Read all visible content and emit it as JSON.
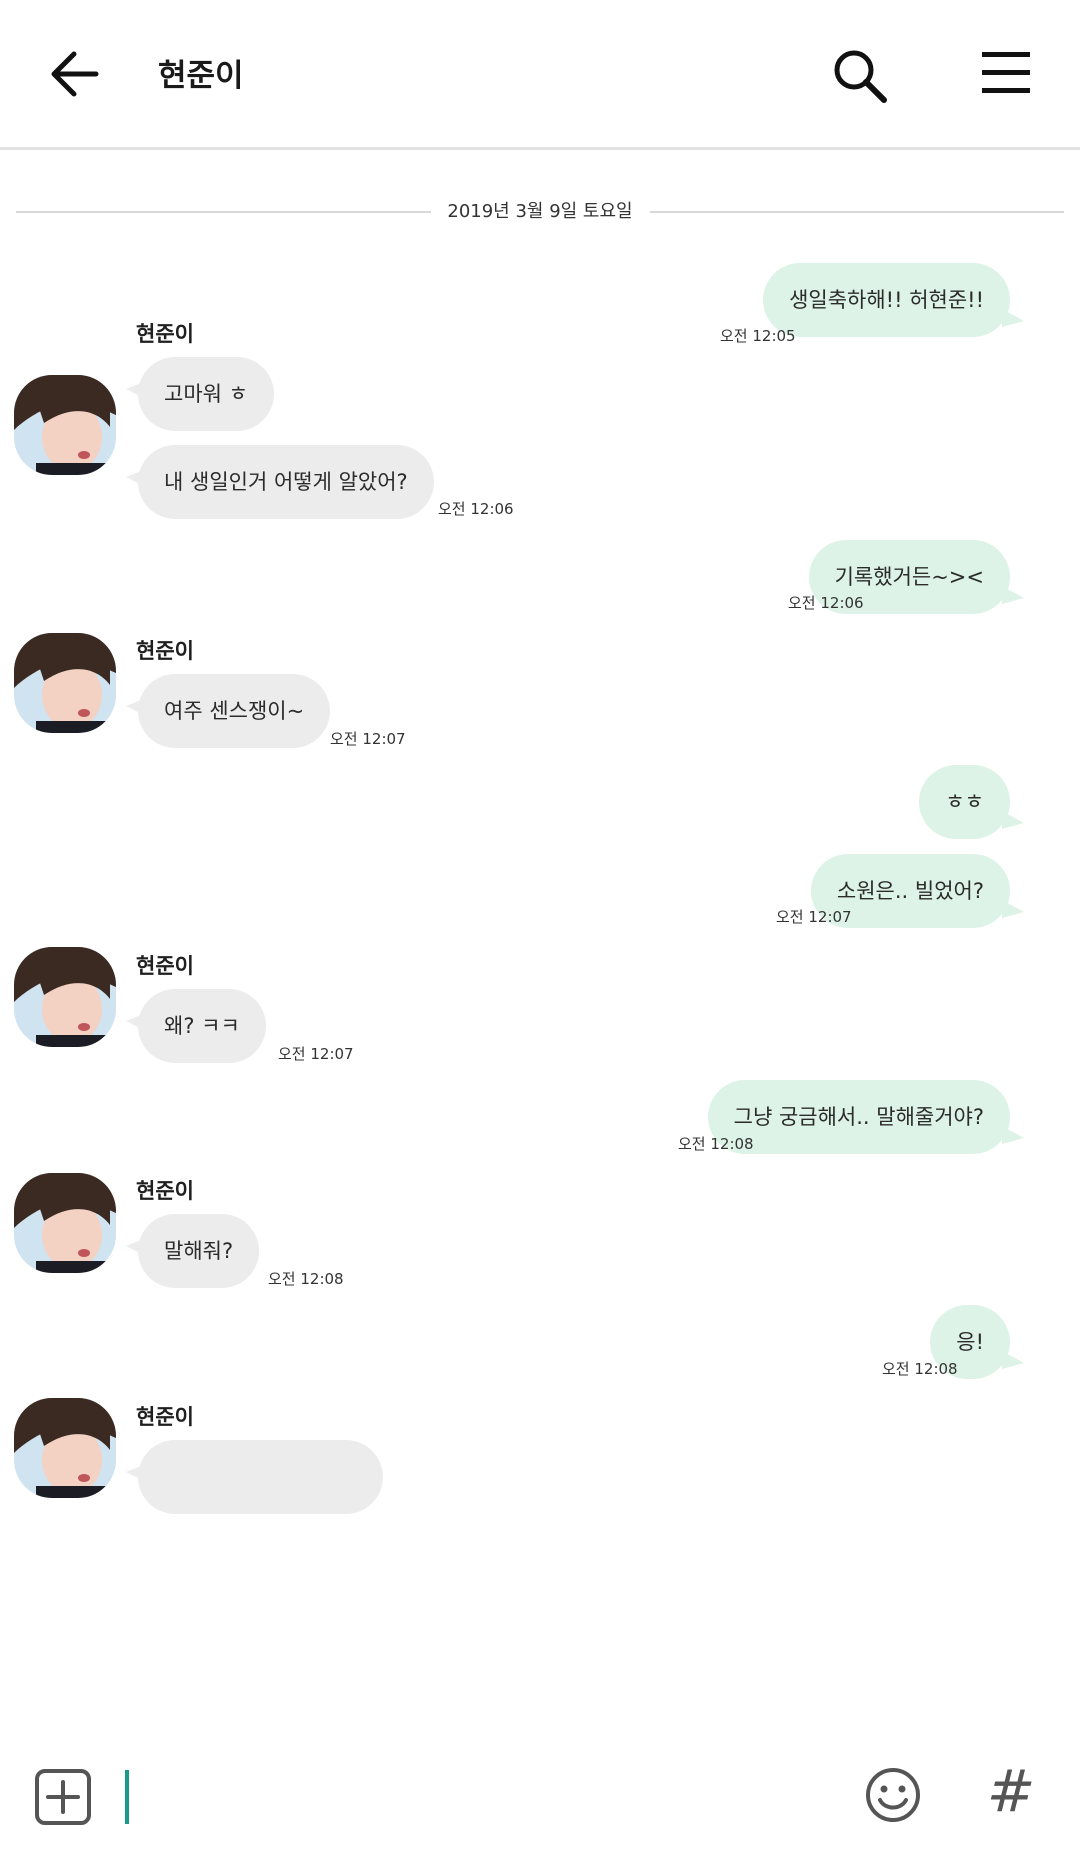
{
  "header": {
    "title": "현준이",
    "back_icon": "arrow-left-icon",
    "search_icon": "search-icon",
    "menu_icon": "hamburger-menu-icon"
  },
  "date_divider": "2019년 3월 9일 토요일",
  "messages": [
    {
      "dir": "out",
      "text": "생일축하해!! 허현준!!",
      "time": "오전 12:05"
    },
    {
      "dir": "in",
      "sender": "현준이",
      "text": "고마워 ㅎ"
    },
    {
      "dir": "in",
      "text": "내 생일인거 어떻게 알았어?",
      "time": "오전 12:06"
    },
    {
      "dir": "out",
      "text": "기록했거든~><",
      "time": "오전 12:06"
    },
    {
      "dir": "in",
      "sender": "현준이",
      "text": "여주 센스쟁이~",
      "time": "오전 12:07"
    },
    {
      "dir": "out",
      "text": "ㅎㅎ"
    },
    {
      "dir": "out",
      "text": "소원은.. 빌었어?",
      "time": "오전 12:07"
    },
    {
      "dir": "in",
      "sender": "현준이",
      "text": "왜? ㅋㅋ",
      "time": "오전 12:07"
    },
    {
      "dir": "out",
      "text": "그냥 궁금해서.. 말해줄거야?",
      "time": "오전 12:08"
    },
    {
      "dir": "in",
      "sender": "현준이",
      "text": "말해줘?",
      "time": "오전 12:08"
    },
    {
      "dir": "out",
      "text": "응!",
      "time": "오전 12:08"
    },
    {
      "dir": "in",
      "sender": "현준이",
      "text": ""
    }
  ],
  "input": {
    "placeholder": "",
    "plus_icon": "plus-square-icon",
    "emoji_icon": "smiley-icon",
    "hashtag_icon": "hashtag-icon",
    "hash_glyph": "#"
  },
  "colors": {
    "outgoing_bubble": "#ddf3e7",
    "incoming_bubble": "#ececec",
    "caret": "#1a9b8a"
  }
}
